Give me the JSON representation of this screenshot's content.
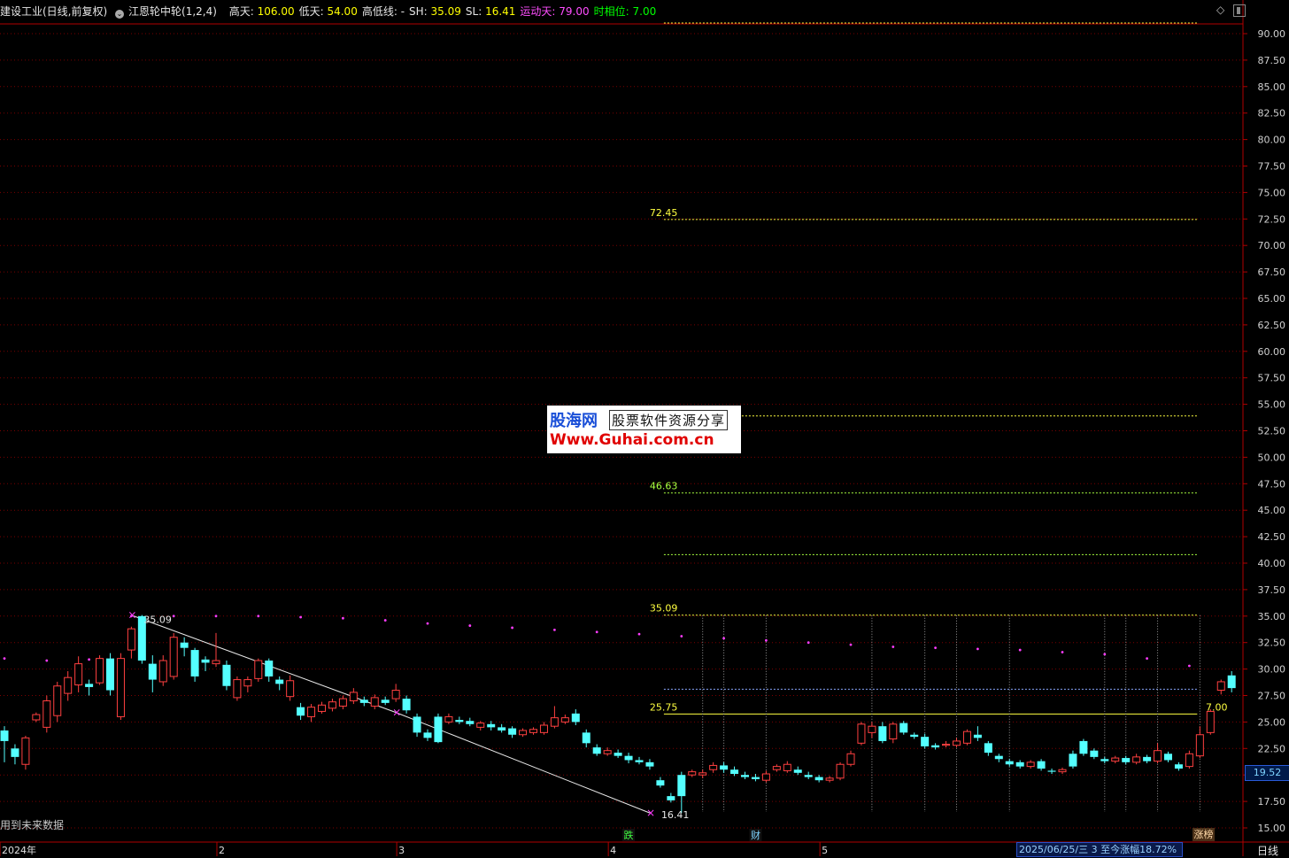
{
  "header": {
    "stock_title": "建设工业(日线,前复权)",
    "indicator_name": "江恩轮中轮(1,2,4)",
    "items": [
      {
        "key": "高天:",
        "value": "106.00",
        "color": "yellow"
      },
      {
        "key": "低天:",
        "value": "54.00",
        "color": "yellow"
      },
      {
        "key": "高低线:",
        "value": "-",
        "color": "white"
      },
      {
        "key": "SH:",
        "value": "35.09",
        "color": "yellow"
      },
      {
        "key": "SL:",
        "value": "16.41",
        "color": "yellow"
      },
      {
        "key": "运动天:",
        "value": "79.00",
        "color": "magenta"
      },
      {
        "key": "时相位:",
        "value": "7.00",
        "color": "green"
      }
    ]
  },
  "watermark": {
    "line1_brand": "股海网",
    "line1_tag": "股票软件资源分享",
    "line2": "Www.Guhai.com.cn"
  },
  "footer": {
    "future_note": "用到未来数据",
    "daily_label": "日线",
    "status_text": "2025/06/25/三  3 至今涨幅18.72%",
    "rise_button": "涨榜",
    "current_price": "19.52"
  },
  "colors": {
    "up": "#ff4040",
    "down": "#54ffff",
    "grid": "#7a0000",
    "level_yellow": "#ffff40",
    "level_green": "#a8ff40",
    "level_blue": "#8aa8ff",
    "magenta": "#ff3cff"
  },
  "chart_data": {
    "type": "candlestick",
    "y_axis": {
      "min": 15.0,
      "max": 90.0,
      "step": 2.5,
      "ticks": [
        "15.00",
        "17.50",
        "20.00",
        "22.50",
        "25.00",
        "27.50",
        "30.00",
        "32.50",
        "35.00",
        "37.50",
        "40.00",
        "42.50",
        "45.00",
        "47.50",
        "50.00",
        "52.50",
        "55.00",
        "57.50",
        "60.00",
        "62.50",
        "65.00",
        "67.50",
        "70.00",
        "72.50",
        "75.00",
        "77.50",
        "80.00",
        "82.50",
        "85.00",
        "87.50",
        "90.00"
      ]
    },
    "x_axis": {
      "months": [
        {
          "label": "2024年",
          "bar": 0
        },
        {
          "label": "2",
          "bar": 20
        },
        {
          "label": "3",
          "bar": 37
        },
        {
          "label": "4",
          "bar": 57
        },
        {
          "label": "5",
          "bar": 77
        }
      ],
      "bar_count": 114
    },
    "levels": [
      {
        "value": 91.0,
        "label": "",
        "color": "yellow"
      },
      {
        "value": 72.45,
        "label": "72.45",
        "color": "yellow"
      },
      {
        "value": 53.9,
        "label": "",
        "color": "yellow"
      },
      {
        "value": 46.63,
        "label": "46.63",
        "color": "green"
      },
      {
        "value": 40.8,
        "label": "",
        "color": "green"
      },
      {
        "value": 35.09,
        "label": "35.09",
        "color": "yellow"
      },
      {
        "value": 28.1,
        "label": "",
        "color": "blue"
      },
      {
        "value": 25.75,
        "label": "25.75",
        "color": "yellow"
      }
    ],
    "level_x_start_bar": 62,
    "level_x_end_bar": 113,
    "right_label": {
      "value": 25.75,
      "text": "7.00"
    },
    "swing_high": {
      "bar": 12,
      "value": 35.09,
      "label": "35.09"
    },
    "swing_low": {
      "bar": 61,
      "value": 16.41,
      "label": "16.41"
    },
    "trend_line": [
      {
        "bar": 12,
        "value": 35.09
      },
      {
        "bar": 37,
        "value": 25.9
      },
      {
        "bar": 61,
        "value": 16.41
      }
    ],
    "cycle_lines_bars": [
      66,
      68,
      72,
      82,
      87,
      90,
      95,
      104,
      106,
      109,
      113
    ],
    "cycle_line_top": 35.09,
    "cycle_line_bottom": 16.5,
    "event_markers": [
      {
        "bar": 59,
        "text": "跌",
        "color": "#40ff40"
      },
      {
        "bar": 71,
        "text": "财",
        "color": "#7fd4ff"
      }
    ],
    "magenta_dots": [
      {
        "bar": 0,
        "value": 31.0
      },
      {
        "bar": 4,
        "value": 30.8
      },
      {
        "bar": 8,
        "value": 30.9
      },
      {
        "bar": 12,
        "value": 35.0
      },
      {
        "bar": 16,
        "value": 35.0
      },
      {
        "bar": 20,
        "value": 35.0
      },
      {
        "bar": 24,
        "value": 35.0
      },
      {
        "bar": 28,
        "value": 34.9
      },
      {
        "bar": 32,
        "value": 34.8
      },
      {
        "bar": 36,
        "value": 34.6
      },
      {
        "bar": 40,
        "value": 34.3
      },
      {
        "bar": 44,
        "value": 34.1
      },
      {
        "bar": 48,
        "value": 33.9
      },
      {
        "bar": 52,
        "value": 33.7
      },
      {
        "bar": 56,
        "value": 33.5
      },
      {
        "bar": 60,
        "value": 33.3
      },
      {
        "bar": 64,
        "value": 33.1
      },
      {
        "bar": 68,
        "value": 32.9
      },
      {
        "bar": 72,
        "value": 32.7
      },
      {
        "bar": 76,
        "value": 32.5
      },
      {
        "bar": 80,
        "value": 32.3
      },
      {
        "bar": 84,
        "value": 32.1
      },
      {
        "bar": 88,
        "value": 32.0
      },
      {
        "bar": 92,
        "value": 31.9
      },
      {
        "bar": 96,
        "value": 31.8
      },
      {
        "bar": 100,
        "value": 31.6
      },
      {
        "bar": 104,
        "value": 31.4
      },
      {
        "bar": 108,
        "value": 31.0
      },
      {
        "bar": 112,
        "value": 30.3
      }
    ],
    "candles": [
      {
        "o": 24.2,
        "c": 23.2,
        "h": 24.6,
        "l": 21.2
      },
      {
        "o": 22.5,
        "c": 21.7,
        "h": 22.9,
        "l": 21.0
      },
      {
        "o": 21.0,
        "c": 23.5,
        "h": 23.7,
        "l": 20.5
      },
      {
        "o": 25.2,
        "c": 25.7,
        "h": 25.9,
        "l": 25.0
      },
      {
        "o": 24.5,
        "c": 27.0,
        "h": 27.5,
        "l": 24.0
      },
      {
        "o": 25.6,
        "c": 28.4,
        "h": 28.8,
        "l": 25.0
      },
      {
        "o": 27.7,
        "c": 29.2,
        "h": 29.8,
        "l": 27.0
      },
      {
        "o": 28.5,
        "c": 30.5,
        "h": 31.2,
        "l": 27.8
      },
      {
        "o": 28.6,
        "c": 28.3,
        "h": 29.0,
        "l": 27.5
      },
      {
        "o": 28.7,
        "c": 31.0,
        "h": 31.3,
        "l": 28.5
      },
      {
        "o": 31.0,
        "c": 28.0,
        "h": 31.5,
        "l": 27.5
      },
      {
        "o": 25.5,
        "c": 31.0,
        "h": 31.5,
        "l": 25.2
      },
      {
        "o": 31.8,
        "c": 33.8,
        "h": 34.0,
        "l": 31.0
      },
      {
        "o": 35.0,
        "c": 30.8,
        "h": 35.1,
        "l": 30.5
      },
      {
        "o": 30.5,
        "c": 29.0,
        "h": 31.3,
        "l": 27.8
      },
      {
        "o": 28.8,
        "c": 30.8,
        "h": 31.3,
        "l": 28.4
      },
      {
        "o": 29.3,
        "c": 33.0,
        "h": 33.4,
        "l": 29.0
      },
      {
        "o": 32.5,
        "c": 32.0,
        "h": 33.0,
        "l": 31.2
      },
      {
        "o": 31.8,
        "c": 29.3,
        "h": 32.0,
        "l": 28.8
      },
      {
        "o": 30.9,
        "c": 30.6,
        "h": 31.2,
        "l": 29.8
      },
      {
        "o": 30.5,
        "c": 30.8,
        "h": 33.4,
        "l": 30.2
      },
      {
        "o": 30.4,
        "c": 28.4,
        "h": 30.8,
        "l": 28.0
      },
      {
        "o": 27.3,
        "c": 29.0,
        "h": 29.3,
        "l": 27.0
      },
      {
        "o": 28.4,
        "c": 29.0,
        "h": 29.3,
        "l": 27.8
      },
      {
        "o": 29.1,
        "c": 30.8,
        "h": 31.0,
        "l": 28.8
      },
      {
        "o": 30.8,
        "c": 29.3,
        "h": 31.0,
        "l": 28.8
      },
      {
        "o": 29.0,
        "c": 28.6,
        "h": 29.3,
        "l": 28.0
      },
      {
        "o": 27.4,
        "c": 28.9,
        "h": 29.4,
        "l": 27.0
      },
      {
        "o": 26.4,
        "c": 25.6,
        "h": 26.8,
        "l": 25.2
      },
      {
        "o": 25.5,
        "c": 26.4,
        "h": 26.7,
        "l": 25.0
      },
      {
        "o": 26.0,
        "c": 26.6,
        "h": 26.9,
        "l": 25.8
      },
      {
        "o": 26.3,
        "c": 26.9,
        "h": 27.2,
        "l": 26.0
      },
      {
        "o": 26.5,
        "c": 27.2,
        "h": 27.5,
        "l": 26.2
      },
      {
        "o": 27.0,
        "c": 27.8,
        "h": 28.2,
        "l": 26.7
      },
      {
        "o": 27.1,
        "c": 26.8,
        "h": 27.4,
        "l": 26.5
      },
      {
        "o": 26.5,
        "c": 27.3,
        "h": 27.6,
        "l": 26.2
      },
      {
        "o": 27.1,
        "c": 26.8,
        "h": 27.4,
        "l": 26.6
      },
      {
        "o": 27.2,
        "c": 28.0,
        "h": 28.6,
        "l": 26.9
      },
      {
        "o": 27.2,
        "c": 26.1,
        "h": 27.5,
        "l": 25.8
      },
      {
        "o": 25.5,
        "c": 24.0,
        "h": 25.8,
        "l": 23.6
      },
      {
        "o": 24.0,
        "c": 23.5,
        "h": 24.3,
        "l": 23.2
      },
      {
        "o": 25.5,
        "c": 23.1,
        "h": 25.8,
        "l": 23.0
      },
      {
        "o": 25.0,
        "c": 25.5,
        "h": 25.8,
        "l": 24.8
      },
      {
        "o": 25.2,
        "c": 25.0,
        "h": 25.5,
        "l": 24.8
      },
      {
        "o": 25.1,
        "c": 24.8,
        "h": 25.4,
        "l": 24.6
      },
      {
        "o": 24.5,
        "c": 24.9,
        "h": 25.1,
        "l": 24.2
      },
      {
        "o": 24.8,
        "c": 24.5,
        "h": 25.1,
        "l": 24.2
      },
      {
        "o": 24.5,
        "c": 24.2,
        "h": 24.8,
        "l": 24.0
      },
      {
        "o": 24.4,
        "c": 23.8,
        "h": 24.6,
        "l": 23.5
      },
      {
        "o": 23.8,
        "c": 24.2,
        "h": 24.4,
        "l": 23.6
      },
      {
        "o": 24.0,
        "c": 24.3,
        "h": 24.5,
        "l": 23.8
      },
      {
        "o": 24.0,
        "c": 24.7,
        "h": 25.0,
        "l": 23.8
      },
      {
        "o": 24.6,
        "c": 25.4,
        "h": 26.5,
        "l": 24.4
      },
      {
        "o": 25.0,
        "c": 25.4,
        "h": 25.7,
        "l": 24.8
      },
      {
        "o": 25.8,
        "c": 25.0,
        "h": 26.2,
        "l": 24.7
      },
      {
        "o": 24.0,
        "c": 23.0,
        "h": 24.3,
        "l": 22.6
      },
      {
        "o": 22.6,
        "c": 22.0,
        "h": 22.9,
        "l": 21.8
      },
      {
        "o": 22.0,
        "c": 22.3,
        "h": 22.6,
        "l": 21.8
      },
      {
        "o": 22.1,
        "c": 21.8,
        "h": 22.4,
        "l": 21.6
      },
      {
        "o": 21.8,
        "c": 21.4,
        "h": 22.1,
        "l": 21.1
      },
      {
        "o": 21.4,
        "c": 21.2,
        "h": 21.7,
        "l": 21.0
      },
      {
        "o": 21.2,
        "c": 20.8,
        "h": 21.5,
        "l": 20.5
      },
      {
        "o": 19.5,
        "c": 19.0,
        "h": 19.8,
        "l": 18.8
      },
      {
        "o": 18.0,
        "c": 17.6,
        "h": 18.3,
        "l": 17.4
      },
      {
        "o": 20.0,
        "c": 18.0,
        "h": 20.3,
        "l": 16.41
      },
      {
        "o": 20.0,
        "c": 20.3,
        "h": 20.5,
        "l": 19.8
      },
      {
        "o": 20.0,
        "c": 20.2,
        "h": 20.5,
        "l": 19.7
      },
      {
        "o": 20.5,
        "c": 20.9,
        "h": 21.2,
        "l": 20.2
      },
      {
        "o": 20.9,
        "c": 20.5,
        "h": 21.2,
        "l": 20.2
      },
      {
        "o": 20.5,
        "c": 20.1,
        "h": 20.8,
        "l": 19.9
      },
      {
        "o": 20.0,
        "c": 19.8,
        "h": 20.3,
        "l": 19.6
      },
      {
        "o": 19.8,
        "c": 19.6,
        "h": 20.1,
        "l": 19.4
      },
      {
        "o": 19.5,
        "c": 20.1,
        "h": 20.4,
        "l": 19.3
      },
      {
        "o": 20.5,
        "c": 20.8,
        "h": 21.0,
        "l": 20.3
      },
      {
        "o": 20.4,
        "c": 21.0,
        "h": 21.3,
        "l": 20.2
      },
      {
        "o": 20.5,
        "c": 20.2,
        "h": 20.8,
        "l": 20.0
      },
      {
        "o": 20.0,
        "c": 19.8,
        "h": 20.3,
        "l": 19.6
      },
      {
        "o": 19.8,
        "c": 19.5,
        "h": 20.0,
        "l": 19.3
      },
      {
        "o": 19.5,
        "c": 19.7,
        "h": 19.9,
        "l": 19.3
      },
      {
        "o": 19.7,
        "c": 21.0,
        "h": 21.2,
        "l": 19.5
      },
      {
        "o": 21.0,
        "c": 22.0,
        "h": 22.3,
        "l": 20.8
      },
      {
        "o": 23.0,
        "c": 24.8,
        "h": 25.0,
        "l": 22.8
      },
      {
        "o": 24.0,
        "c": 24.6,
        "h": 25.0,
        "l": 23.5
      },
      {
        "o": 24.6,
        "c": 23.2,
        "h": 25.0,
        "l": 23.0
      },
      {
        "o": 23.4,
        "c": 24.8,
        "h": 25.0,
        "l": 23.0
      },
      {
        "o": 24.9,
        "c": 24.0,
        "h": 25.1,
        "l": 23.8
      },
      {
        "o": 23.8,
        "c": 23.6,
        "h": 24.0,
        "l": 23.4
      },
      {
        "o": 23.6,
        "c": 22.7,
        "h": 23.9,
        "l": 22.5
      },
      {
        "o": 22.8,
        "c": 22.6,
        "h": 23.0,
        "l": 22.4
      },
      {
        "o": 22.8,
        "c": 22.9,
        "h": 23.2,
        "l": 22.6
      },
      {
        "o": 22.8,
        "c": 23.2,
        "h": 23.5,
        "l": 22.6
      },
      {
        "o": 23.0,
        "c": 24.1,
        "h": 24.3,
        "l": 22.8
      },
      {
        "o": 23.8,
        "c": 23.5,
        "h": 24.6,
        "l": 23.2
      },
      {
        "o": 23.0,
        "c": 22.1,
        "h": 23.2,
        "l": 21.8
      },
      {
        "o": 21.8,
        "c": 21.5,
        "h": 22.0,
        "l": 21.2
      },
      {
        "o": 21.3,
        "c": 21.0,
        "h": 21.5,
        "l": 20.8
      },
      {
        "o": 21.2,
        "c": 20.8,
        "h": 21.4,
        "l": 20.6
      },
      {
        "o": 20.8,
        "c": 21.2,
        "h": 21.4,
        "l": 20.6
      },
      {
        "o": 21.3,
        "c": 20.6,
        "h": 21.5,
        "l": 20.4
      },
      {
        "o": 20.4,
        "c": 20.3,
        "h": 20.6,
        "l": 20.1
      },
      {
        "o": 20.3,
        "c": 20.5,
        "h": 20.7,
        "l": 20.1
      },
      {
        "o": 22.0,
        "c": 20.8,
        "h": 22.3,
        "l": 20.6
      },
      {
        "o": 23.2,
        "c": 22.0,
        "h": 23.4,
        "l": 21.8
      },
      {
        "o": 22.3,
        "c": 21.7,
        "h": 22.5,
        "l": 21.5
      },
      {
        "o": 21.5,
        "c": 21.3,
        "h": 21.7,
        "l": 21.1
      },
      {
        "o": 21.3,
        "c": 21.6,
        "h": 21.8,
        "l": 21.1
      },
      {
        "o": 21.6,
        "c": 21.2,
        "h": 21.8,
        "l": 21.0
      },
      {
        "o": 21.2,
        "c": 21.7,
        "h": 22.0,
        "l": 21.0
      },
      {
        "o": 21.7,
        "c": 21.3,
        "h": 21.9,
        "l": 21.1
      },
      {
        "o": 21.3,
        "c": 22.3,
        "h": 23.0,
        "l": 21.1
      },
      {
        "o": 22.0,
        "c": 21.4,
        "h": 22.2,
        "l": 21.2
      },
      {
        "o": 21.0,
        "c": 20.6,
        "h": 21.2,
        "l": 20.4
      },
      {
        "o": 20.8,
        "c": 22.0,
        "h": 22.3,
        "l": 20.6
      },
      {
        "o": 21.8,
        "c": 23.8,
        "h": 24.6,
        "l": 21.6
      },
      {
        "o": 24.0,
        "c": 26.0,
        "h": 26.2,
        "l": 23.8
      },
      {
        "o": 28.0,
        "c": 28.8,
        "h": 29.0,
        "l": 27.6
      },
      {
        "o": 29.4,
        "c": 28.2,
        "h": 29.8,
        "l": 27.8
      }
    ]
  }
}
